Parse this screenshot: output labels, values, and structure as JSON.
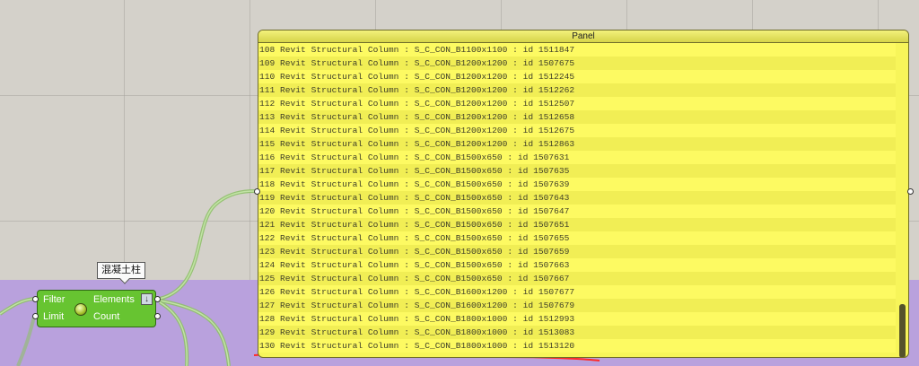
{
  "panel": {
    "title": "Panel",
    "rows": [
      "108 Revit Structural Column : S_C_CON_B1100x1100 : id 1511847",
      "109 Revit Structural Column : S_C_CON_B1200x1200 : id 1507675",
      "110 Revit Structural Column : S_C_CON_B1200x1200 : id 1512245",
      "111 Revit Structural Column : S_C_CON_B1200x1200 : id 1512262",
      "112 Revit Structural Column : S_C_CON_B1200x1200 : id 1512507",
      "113 Revit Structural Column : S_C_CON_B1200x1200 : id 1512658",
      "114 Revit Structural Column : S_C_CON_B1200x1200 : id 1512675",
      "115 Revit Structural Column : S_C_CON_B1200x1200 : id 1512863",
      "116 Revit Structural Column : S_C_CON_B1500x650 : id 1507631",
      "117 Revit Structural Column : S_C_CON_B1500x650 : id 1507635",
      "118 Revit Structural Column : S_C_CON_B1500x650 : id 1507639",
      "119 Revit Structural Column : S_C_CON_B1500x650 : id 1507643",
      "120 Revit Structural Column : S_C_CON_B1500x650 : id 1507647",
      "121 Revit Structural Column : S_C_CON_B1500x650 : id 1507651",
      "122 Revit Structural Column : S_C_CON_B1500x650 : id 1507655",
      "123 Revit Structural Column : S_C_CON_B1500x650 : id 1507659",
      "124 Revit Structural Column : S_C_CON_B1500x650 : id 1507663",
      "125 Revit Structural Column : S_C_CON_B1500x650 : id 1507667",
      "126 Revit Structural Column : S_C_CON_B1600x1200 : id 1507677",
      "127 Revit Structural Column : S_C_CON_B1600x1200 : id 1507679",
      "128 Revit Structural Column : S_C_CON_B1800x1000 : id 1512993",
      "129 Revit Structural Column : S_C_CON_B1800x1000 : id 1513083",
      "130 Revit Structural Column : S_C_CON_B1800x1000 : id 1513120"
    ]
  },
  "component": {
    "nickname": "混凝土柱",
    "inputs": [
      "Filter",
      "Limit"
    ],
    "outputs": [
      "Elements",
      "Count"
    ],
    "icon": "arrow-down-icon"
  },
  "colors": {
    "canvas": "#d4d1ca",
    "group": "#b9a1dd",
    "panel": "#f7f55a",
    "component": "#67c431",
    "wire": "#8fc76a",
    "underline": "#ff2a2a"
  }
}
